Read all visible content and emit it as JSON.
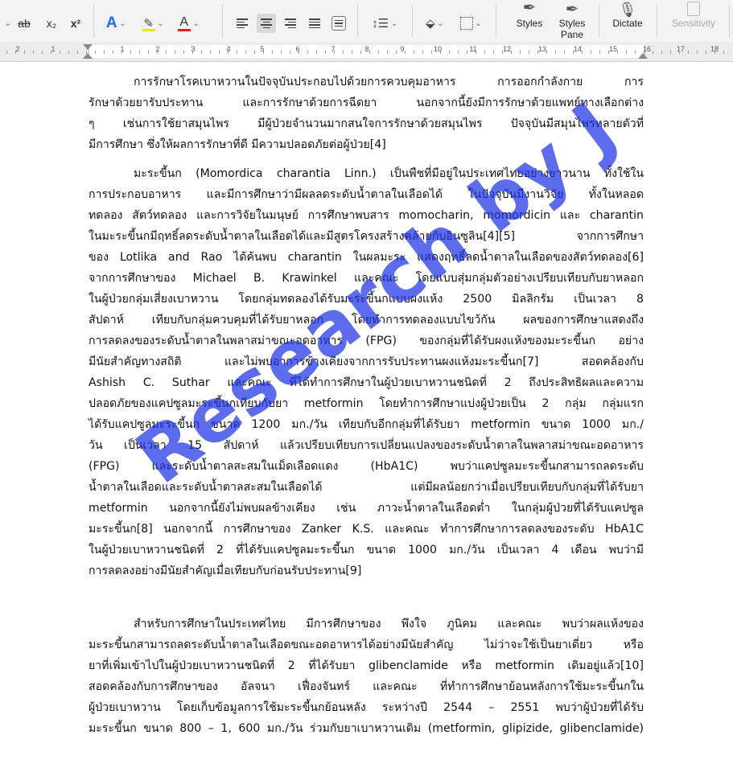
{
  "ribbon": {
    "strikethrough": "ab",
    "subscript": "x₂",
    "superscript": "x²",
    "text_effects_icon": "A",
    "highlight_color": "#f4e800",
    "font_color": "#e0201e",
    "styles_label": "Styles",
    "styles_pane_label_1": "Styles",
    "styles_pane_label_2": "Pane",
    "dictate_label": "Dictate",
    "sensitivity_label": "Sensitivity",
    "text_effects_color": "#2b6de3"
  },
  "ruler": {
    "numbers": [
      "2",
      "1",
      "1",
      "2",
      "3",
      "4",
      "5",
      "6",
      "7",
      "8",
      "9",
      "10",
      "11",
      "12",
      "13",
      "14",
      "15",
      "16",
      "17",
      "18"
    ]
  },
  "document": {
    "paragraphs": [
      [
        "การรักษาโรคเบาหวานในปัจจุบันประกอบไปด้วยการควบคุมอาหาร การออกกำลังกาย การ",
        "รักษาด้วยยารับประทาน และการรักษาด้วยการฉีดยา นอกจากนี้ยังมีการรักษาด้วยแพทย์ทางเลือกต่าง",
        "ๆ เช่นการใช้ยาสมุนไพร มีผู้ป่วยจำนวนมากสนใจการรักษาด้วยสมุนไพร ปัจจุบันมีสมุนไพรหลายตัวที่",
        "มีการศึกษา ซึ่งให้ผลการรักษาที่ดี มีความปลอดภัยต่อผู้ป่วย[4]"
      ],
      [
        "มะระขี้นก (Momordica charantia Linn.) เป็นพืชที่มีอยู่ในประเทศไทยอย่างยาวนาน ทั้งใช้ใน",
        "การประกอบอาหาร และมีการศึกษาว่ามีผลลดระดับน้ำตาลในเลือดได้ ในปัจจุบันมีงานวิจัย ทั้งในหลอด",
        "ทดลอง สัตว์ทดลอง และการวิจัยในมนุษย์ การศึกษาพบสาร momocharin, momordicin และ charantin",
        "ในมะระขี้นกมีฤทธิ์ลดระดับน้ำตาลในเลือดได้และมีสูตรโครงสร้างคล้ายกับอินซูลิน[4][5] จากการศึกษา",
        "ของ Lotlika and Rao ได้ค้นพบ charantin ในผลมะระ แสดงฤทธิ์ลดน้ำตาลในเลือดของสัตว์ทดลอง[6]",
        "จากการศึกษาของ Michael B. Krawinkel และคณะ โดยแบบสุ่มกลุ่มตัวอย่างเปรียบเทียบกับยาหลอก",
        "ในผู้ป่วยกลุ่มเสี่ยงเบาหวาน โดยกลุ่มทดลองได้รับมะระขี้นกแบบผงแห้ง 2500 มิลลิกรัม เป็นเวลา 8",
        "สัปดาห์ เทียบกับกลุ่มควบคุมที่ได้รับยาหลอก โดยทำการทดลองแบบไขว้กัน ผลของการศึกษาแสดงถึง",
        "การลดลงของระดับน้ำตาลในพลาสม่าขณะอดอาหาร (FPG) ของกลุ่มที่ได้รับผงแห้งของมะระขี้นก อย่าง",
        "มีนัยสำคัญทางสถิติ และไม่พบอาการข้างเคียงจากการรับประทานผงแห้งมะระขี้นก[7] สอดคล้องกับ",
        "Ashish C. Suthar และคณะ ที่ได้ทำการศึกษาในผู้ป่วยเบาหวานชนิดที่ 2 ถึงประสิทธิผลและความ",
        "ปลอดภัยของแคปซูลมะระขี้นกเทียบกับยา metformin โดยทำการศึกษาแบ่งผู้ป่วยเป็น 2 กลุ่ม กลุ่มแรก",
        "ได้รับแคปซูลมะระขี้นก ขนาด 1200 มก./วัน เทียบกับอีกกลุ่มที่ได้รับยา metformin ขนาด 1000 มก./",
        "วัน เป็นเวลา 15 สัปดาห์ แล้วเปรียบเทียบการเปลี่ยนแปลงของระดับน้ำตาลในพลาสม่าขณะอดอาหาร",
        "(FPG) และระดับน้ำตาลสะสมในเม็ดเลือดแดง (HbA1C) พบว่าแคปซูลมะระขี้นกสามารถลดระดับ",
        "น้ำตาลในเลือดและระดับน้ำตาลสะสมในเลือดได้ แต่มีผลน้อยกว่าเมื่อเปรียบเทียบกับกลุ่มที่ได้รับยา",
        "metformin นอกจากนี้ยังไม่พบผลข้างเคียง เช่น ภาวะน้ำตาลในเลือดต่ำ ในกลุ่มผู้ป่วยที่ได้รับแคปซูล",
        "มะระขี้นก[8] นอกจากนี้ การศึกษาของ Zanker K.S. และคณะ ทำการศึกษาการลดลงของระดับ HbA1C",
        "ในผู้ป่วยเบาหวานชนิดที่ 2 ที่ได้รับแคปซูลมะระขี้นก ขนาด 1000 มก./วัน เป็นเวลา 4 เดือน พบว่ามี",
        "การลดลงอย่างมีนัยสำคัญเมื่อเทียบกับก่อนรับประทาน[9]"
      ],
      [
        "สำหรับการศึกษาในประเทศไทย มีการศึกษาของ พึงใจ ภูนิคม และคณะ พบว่าผลแห้งของ",
        "มะระขี้นกสามารถลดระดับน้ำตาลในเลือดขณะอดอาหารได้อย่างมีนัยสำคัญ ไม่ว่าจะใช้เป็นยาเดี่ยว หรือ",
        "ยาที่เพิ่มเข้าไปในผู้ป่วยเบาหวานชนิดที่ 2 ที่ได้รับยา glibenclamide หรือ metformin เดิมอยู่แล้ว[10]",
        "สอดคล้องกับการศึกษาของ อัลจนา เฟื่องจันทร์ และคณะ ที่ทำการศึกษาย้อนหลังการใช้มะระขี้นกใน",
        "ผู้ป่วยเบาหวาน โดยเก็บข้อมูลการใช้มะระขี้นกย้อนหลัง ระหว่างปี 2544 – 2551 พบว่าผู้ป่วยที่ได้รับ",
        "มะระขี้นก ขนาด 800 – 1, 600 มก./วัน ร่วมกับยาเบาหวานเดิม (metformin, glipizide, glibenclamide)"
      ]
    ],
    "watermark": "Research by J"
  }
}
